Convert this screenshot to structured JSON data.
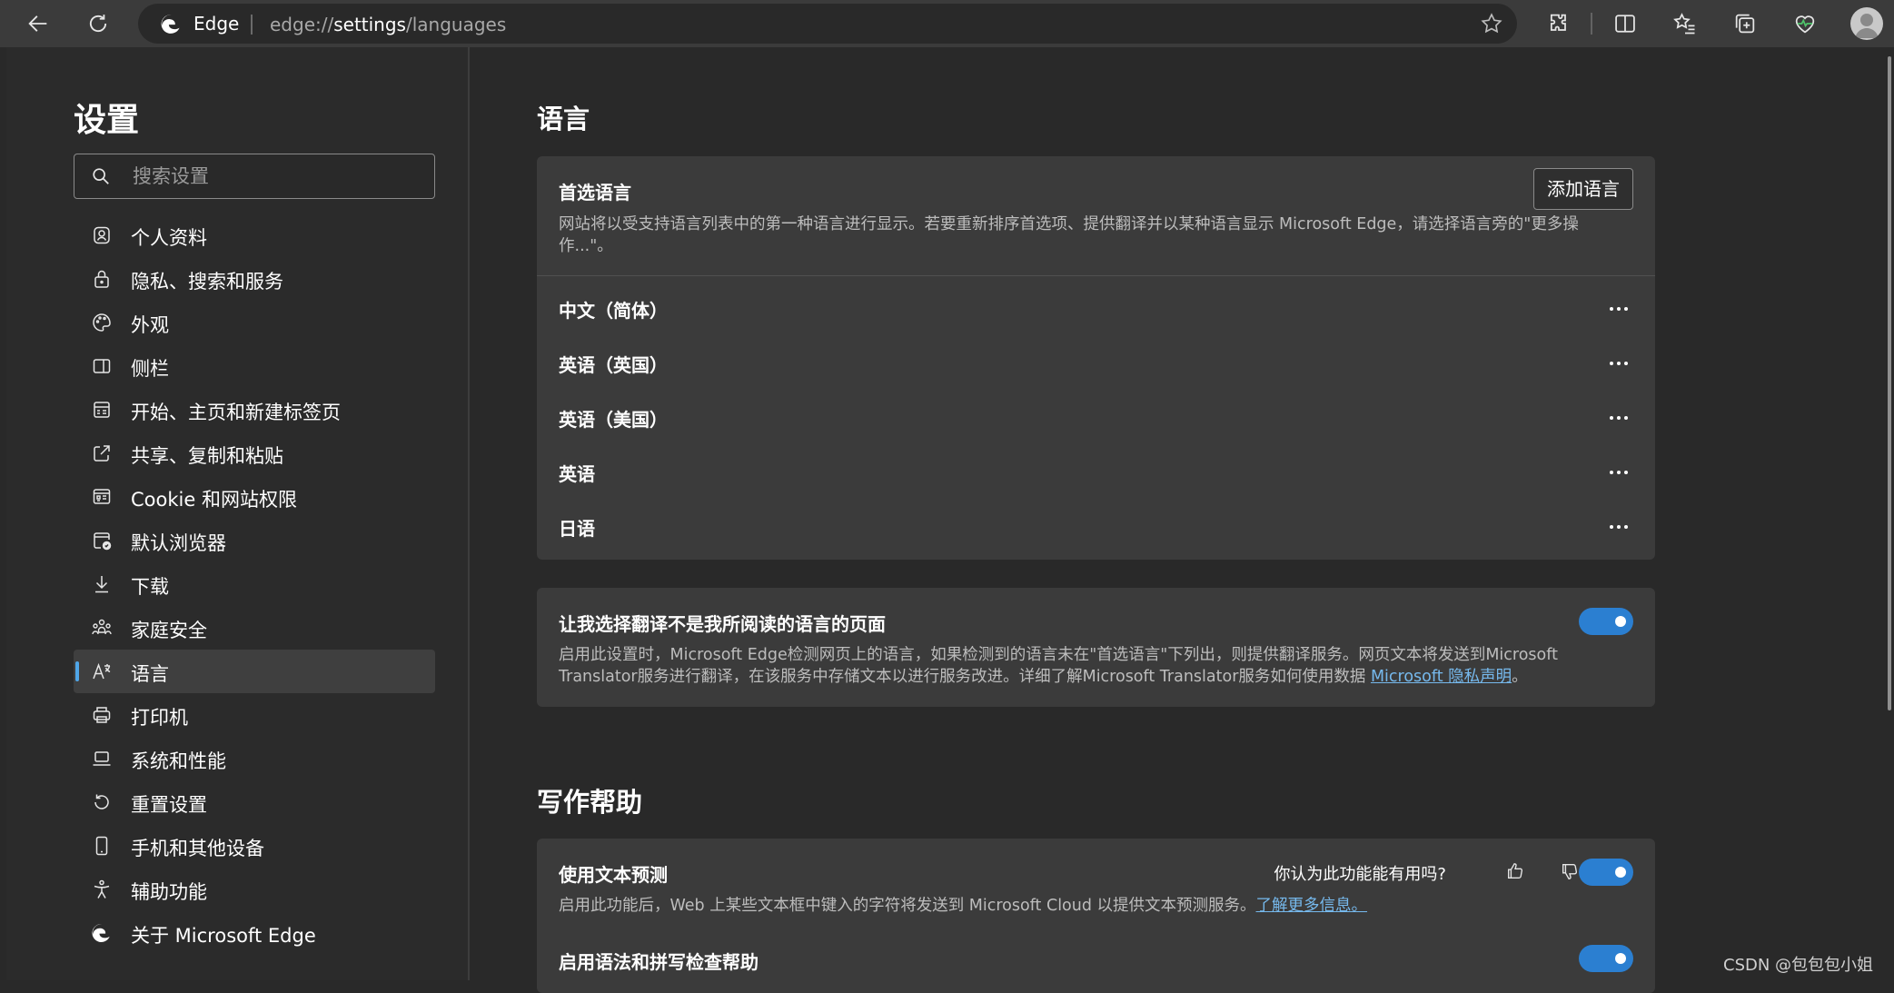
{
  "browser": {
    "site_name": "Edge",
    "url_prefix": "edge://",
    "url_host": "settings",
    "url_path": "/languages"
  },
  "sidebar": {
    "title": "设置",
    "search_placeholder": "搜索设置",
    "items": [
      {
        "label": "个人资料",
        "icon": "profile-icon",
        "active": false
      },
      {
        "label": "隐私、搜索和服务",
        "icon": "lock-icon",
        "active": false
      },
      {
        "label": "外观",
        "icon": "palette-icon",
        "active": false
      },
      {
        "label": "侧栏",
        "icon": "sidebar-icon",
        "active": false
      },
      {
        "label": "开始、主页和新建标签页",
        "icon": "home-page-icon",
        "active": false
      },
      {
        "label": "共享、复制和粘贴",
        "icon": "share-icon",
        "active": false
      },
      {
        "label": "Cookie 和网站权限",
        "icon": "site-permissions-icon",
        "active": false
      },
      {
        "label": "默认浏览器",
        "icon": "default-browser-icon",
        "active": false
      },
      {
        "label": "下载",
        "icon": "download-icon",
        "active": false
      },
      {
        "label": "家庭安全",
        "icon": "family-icon",
        "active": false
      },
      {
        "label": "语言",
        "icon": "language-icon",
        "active": true
      },
      {
        "label": "打印机",
        "icon": "printer-icon",
        "active": false
      },
      {
        "label": "系统和性能",
        "icon": "laptop-icon",
        "active": false
      },
      {
        "label": "重置设置",
        "icon": "reset-icon",
        "active": false
      },
      {
        "label": "手机和其他设备",
        "icon": "phone-icon",
        "active": false
      },
      {
        "label": "辅助功能",
        "icon": "accessibility-icon",
        "active": false
      },
      {
        "label": "关于 Microsoft Edge",
        "icon": "edge-logo-icon",
        "active": false
      }
    ]
  },
  "languages": {
    "section_title": "语言",
    "preferred": {
      "title": "首选语言",
      "description": "网站将以受支持语言列表中的第一种语言进行显示。若要重新排序首选项、提供翻译并以某种语言显示 Microsoft Edge，请选择语言旁的\"更多操作...\"。",
      "add_button": "添加语言",
      "list": [
        "中文（简体）",
        "英语（英国）",
        "英语（美国）",
        "英语",
        "日语"
      ]
    },
    "translate": {
      "title": "让我选择翻译不是我所阅读的语言的页面",
      "description": "启用此设置时，Microsoft Edge检测网页上的语言，如果检测到的语言未在\"首选语言\"下列出，则提供翻译服务。网页文本将发送到Microsoft Translator服务进行翻译，在该服务中存储文本以进行服务改进。详细了解Microsoft Translator服务如何使用数据 ",
      "link": "Microsoft 隐私声明",
      "suffix": "。",
      "enabled": true
    }
  },
  "writing": {
    "section_title": "写作帮助",
    "prediction": {
      "title": "使用文本预测",
      "feedback_question": "你认为此功能能有用吗?",
      "description": "启用此功能后，Web 上某些文本框中键入的字符将发送到 Microsoft Cloud 以提供文本预测服务。",
      "link": "了解更多信息。",
      "enabled": true
    },
    "grammar": {
      "title": "启用语法和拼写检查帮助",
      "enabled": true
    }
  },
  "watermark": "CSDN @包包包小姐",
  "colors": {
    "background": "#292929",
    "card": "#3b3b3b",
    "accent": "#2b7fd1",
    "link": "#76b9ed"
  }
}
